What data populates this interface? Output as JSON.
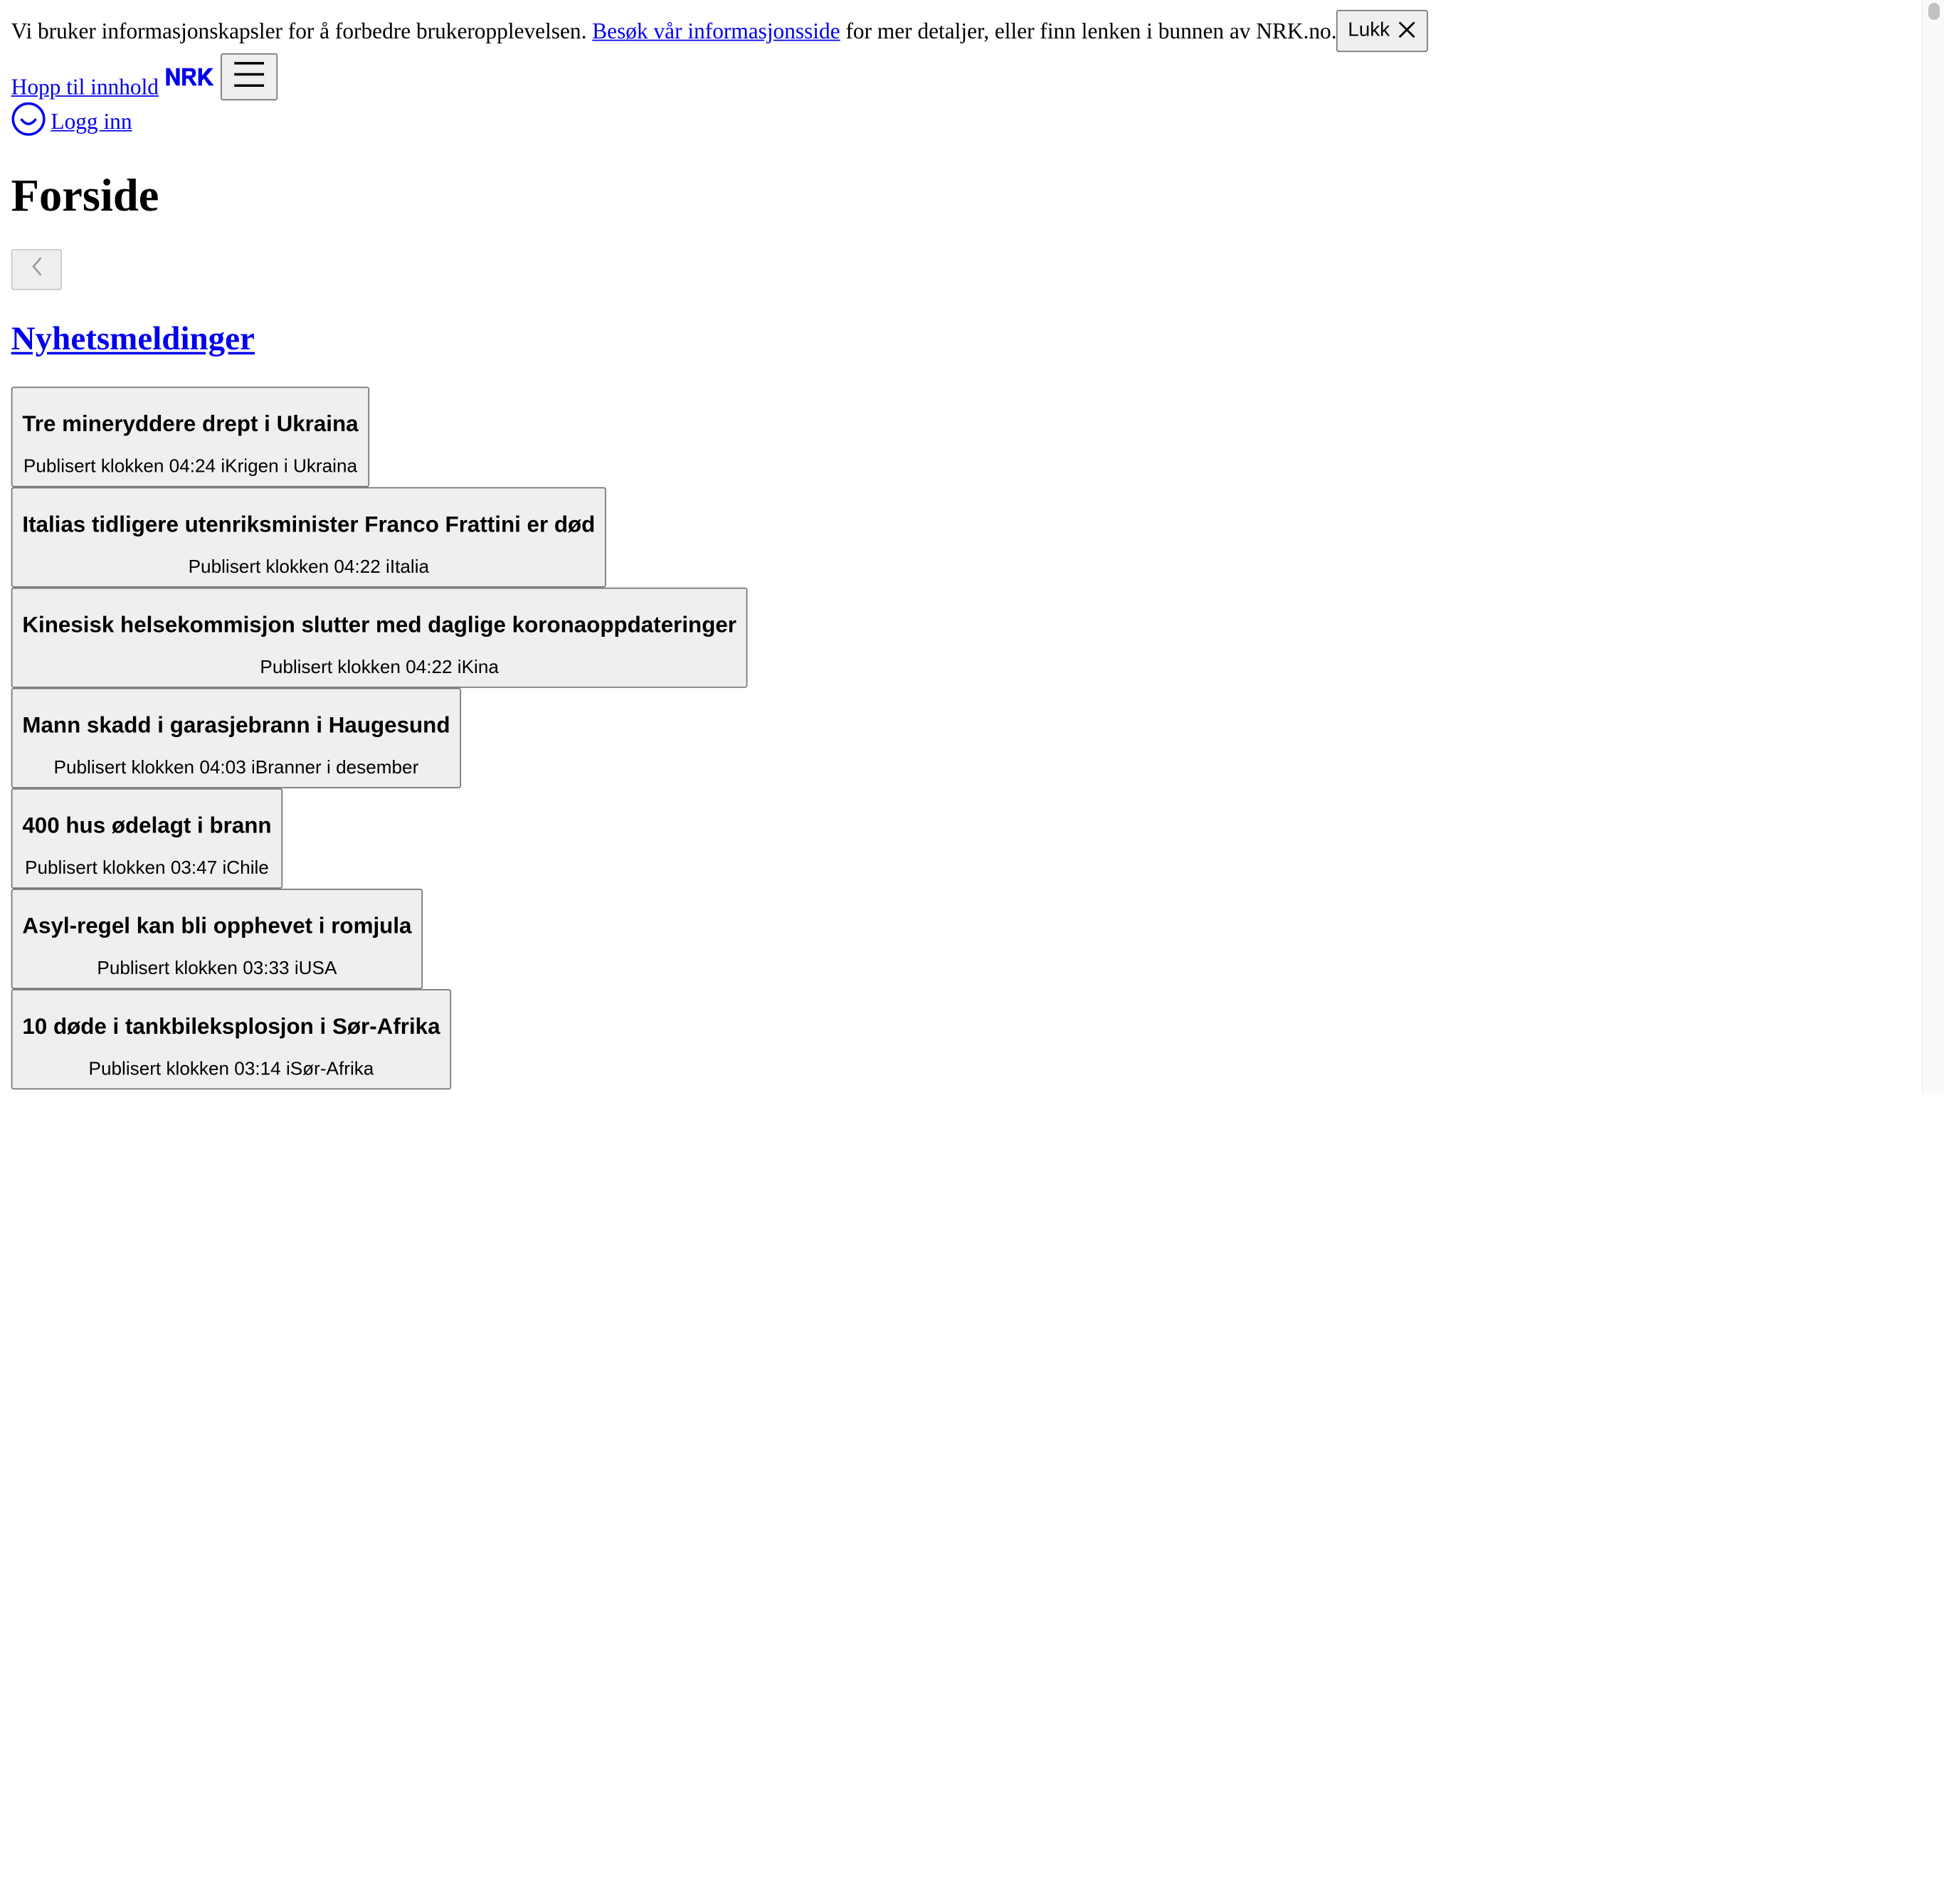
{
  "cookie_banner": {
    "text_before": "Vi bruker informasjonskapsler for å forbedre brukeropplevelsen.",
    "link_text": "Besøk vår informasjonsside",
    "text_after": "for mer detaljer, eller finn lenken i bunnen av NRK.no.",
    "close_label": "Lukk",
    "close_icon": "close-icon"
  },
  "header": {
    "skip_link": "Hopp til innhold",
    "logo_icon": "nrk-logo-icon",
    "logo_text": "NRK",
    "menu_icon": "hamburger-menu-icon",
    "login_icon": "user-smile-icon",
    "login_label": "Logg inn"
  },
  "main": {
    "page_title": "Forside",
    "back_icon": "chevron-left-icon",
    "section_title": "Nyhetsmeldinger",
    "news": [
      {
        "title": "Tre mineryddere drept i Ukraina",
        "meta": "Publisert klokken 04:24 iKrigen i Ukraina"
      },
      {
        "title": "Italias tidligere utenriksminister Franco Frattini er død",
        "meta": "Publisert klokken 04:22 iItalia"
      },
      {
        "title": "Kinesisk helsekommisjon slutter med daglige koronaoppdateringer",
        "meta": "Publisert klokken 04:22 iKina"
      },
      {
        "title": "Mann skadd i garasjebrann i Haugesund",
        "meta": "Publisert klokken 04:03 iBranner i desember"
      },
      {
        "title": "400 hus ødelagt i brann",
        "meta": "Publisert klokken 03:47 iChile"
      },
      {
        "title": "Asyl-regel kan bli opphevet i romjula",
        "meta": "Publisert klokken 03:33 iUSA"
      },
      {
        "title": "10 døde i tankbileksplosjon i Sør-Afrika",
        "meta": "Publisert klokken 03:14 iSør-Afrika"
      }
    ]
  }
}
